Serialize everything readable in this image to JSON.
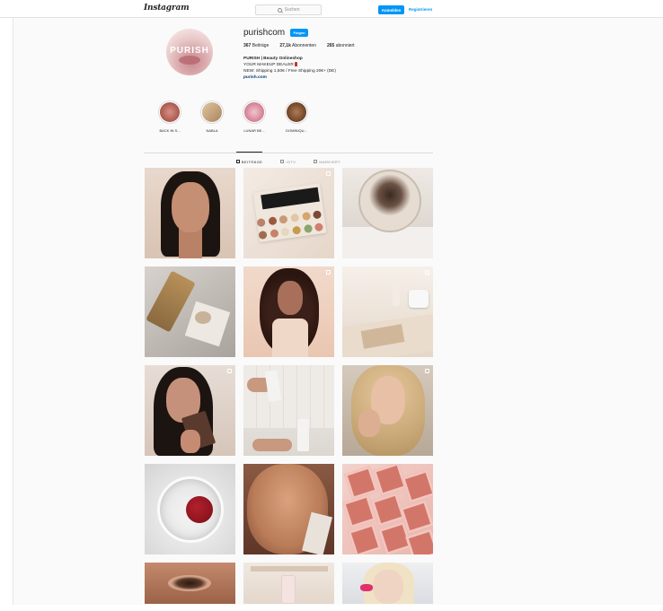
{
  "nav": {
    "logo": "Instagram",
    "search_placeholder": "Suchen",
    "login_label": "Anmelden",
    "register_label": "Registrieren"
  },
  "profile": {
    "avatar_text": "PURISH",
    "username": "purishcom",
    "follow_label": "Folgen",
    "stats": [
      {
        "value": "367",
        "label": "Beiträge"
      },
      {
        "value": "27,1k",
        "label": "Abonnenten"
      },
      {
        "value": "265",
        "label": "abonniert"
      }
    ],
    "bio": {
      "name": "PURISH | Beauty Onlineshop",
      "line1": "YOUR MAKEUP DEALER",
      "line2": "NEW: Shipping 1,50€ / Free Shipping 20€+ (DE)",
      "url": "purish.com"
    }
  },
  "highlights": [
    {
      "label": "BACK IN S...",
      "color": "#b5665e"
    },
    {
      "label": "NABLA",
      "color": "#c7a57e"
    },
    {
      "label": "LUNAR BE...",
      "color": "#e0a3b0"
    },
    {
      "label": "DOMINIQU...",
      "color": "#8b5a3a"
    }
  ],
  "tabs": [
    {
      "label": "BEITRÄGE",
      "active": true
    },
    {
      "label": "IGTV",
      "active": false
    },
    {
      "label": "MARKIERT",
      "active": false
    }
  ],
  "palette_colors": [
    "#b9826a",
    "#9b5a3e",
    "#c99a75",
    "#e2c7a7",
    "#d8a46d",
    "#7b4b34",
    "#a16b4d",
    "#c7826c",
    "#e6d7bf",
    "#c69b4d",
    "#8aa56d",
    "#d17f6e"
  ]
}
